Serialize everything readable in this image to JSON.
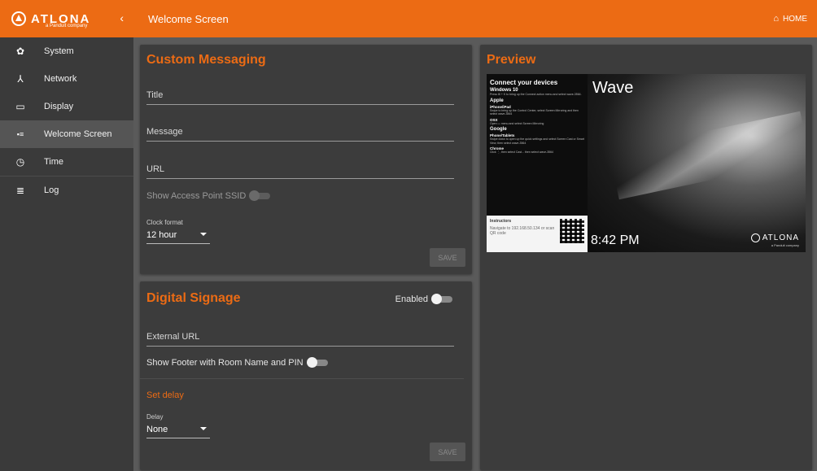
{
  "brand": {
    "name": "ATLONA",
    "sub": "a Panduit company"
  },
  "sidebar": {
    "collapse": "‹",
    "items": [
      {
        "label": "System",
        "icon": "gear-icon",
        "glyph": "✿"
      },
      {
        "label": "Network",
        "icon": "network-icon",
        "glyph": "⅄"
      },
      {
        "label": "Display",
        "icon": "monitor-icon",
        "glyph": "▭"
      },
      {
        "label": "Welcome Screen",
        "icon": "welcome-screen-icon",
        "glyph": "▪≡"
      },
      {
        "label": "Time",
        "icon": "clock-icon",
        "glyph": "◷"
      },
      {
        "label": "Log",
        "icon": "list-icon",
        "glyph": "≣"
      }
    ],
    "active_index": 3
  },
  "header": {
    "title": "Welcome Screen",
    "home_label": "HOME",
    "home_icon": "⌂"
  },
  "custom_messaging": {
    "title": "Custom Messaging",
    "title_placeholder": "Title",
    "message_placeholder": "Message",
    "url_placeholder": "URL",
    "ssid_label": "Show Access Point SSID",
    "ssid_enabled": false,
    "clock_label": "Clock format",
    "clock_value": "12 hour",
    "save_label": "SAVE"
  },
  "digital_signage": {
    "title": "Digital Signage",
    "enabled_label": "Enabled",
    "enabled": false,
    "external_url_placeholder": "External URL",
    "footer_label": "Show Footer with Room Name and PIN",
    "footer_enabled": false,
    "set_delay_heading": "Set delay",
    "delay_label": "Delay",
    "delay_value": "None",
    "save_label": "SAVE"
  },
  "preview": {
    "title": "Preview",
    "connect_heading": "Connect your devices",
    "sections": [
      {
        "heading": "Windows 10",
        "text": "Press ⊞ + K to bring up the Connect action menu and select wave-3564."
      },
      {
        "heading": "Apple",
        "text": ""
      },
      {
        "heading": "iPhone/iPad",
        "text": "Swipe to bring up the Control Center, select Screen Mirroring and then select wave-3564"
      },
      {
        "heading": "OSX",
        "text": "Open ▭ menu and select Screen Mirroring"
      },
      {
        "heading": "Google",
        "text": ""
      },
      {
        "heading": "Phone/Tablets",
        "text": "Swipe down to open up the quick settings and select Screen Cast or Smart View, then select wave-3564"
      },
      {
        "heading": "Chrome",
        "text": "Click ⋮, then select Cast... then select wave-3564"
      }
    ],
    "instructors_heading": "Instructors",
    "instructors_text": "Navigate to 192.168.50.134 or scan QR code",
    "brand_name": "Wave",
    "time": "8:42 PM",
    "logo_text": "ATLONA",
    "logo_sub": "a Panduit company"
  }
}
